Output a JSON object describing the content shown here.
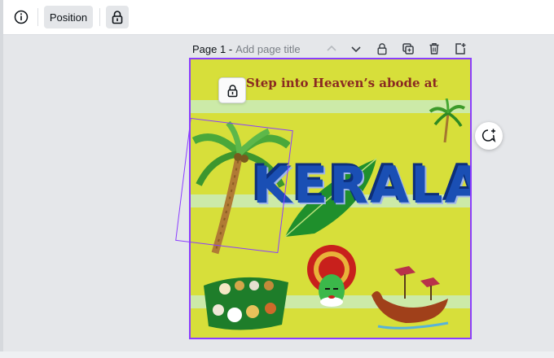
{
  "toolbar": {
    "info_icon": "info-icon",
    "position_label": "Position",
    "lock_icon": "lock-icon"
  },
  "page": {
    "label": "Page 1 -",
    "title_placeholder": "Add page title",
    "icons": [
      "chevron-up-icon",
      "chevron-down-icon",
      "lock-icon",
      "duplicate-icon",
      "trash-icon",
      "add-page-icon"
    ]
  },
  "design": {
    "headline": "Step into Heaven’s abode at",
    "title": "KERALA"
  },
  "colors": {
    "accent": "#8b3dff",
    "canvas_bg": "#d7df3a",
    "headline": "#8a2a22",
    "kerala": "#1a4fb4"
  }
}
